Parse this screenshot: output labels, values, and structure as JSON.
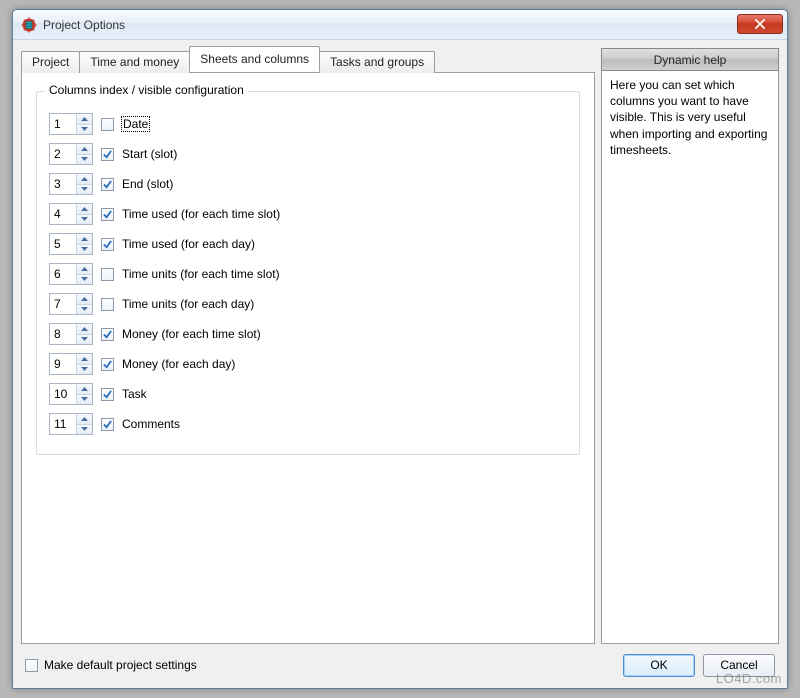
{
  "window": {
    "title": "Project Options"
  },
  "tabs": [
    {
      "label": "Project"
    },
    {
      "label": "Time and money"
    },
    {
      "label": "Sheets and columns"
    },
    {
      "label": "Tasks and groups"
    }
  ],
  "active_tab_index": 2,
  "group_title": "Columns index / visible configuration",
  "columns": [
    {
      "index": "1",
      "checked": false,
      "label": "Date",
      "focused": true
    },
    {
      "index": "2",
      "checked": true,
      "label": "Start (slot)"
    },
    {
      "index": "3",
      "checked": true,
      "label": "End (slot)"
    },
    {
      "index": "4",
      "checked": true,
      "label": "Time used (for each time slot)"
    },
    {
      "index": "5",
      "checked": true,
      "label": "Time used (for each day)"
    },
    {
      "index": "6",
      "checked": false,
      "label": "Time units (for each time slot)"
    },
    {
      "index": "7",
      "checked": false,
      "label": "Time units (for each day)"
    },
    {
      "index": "8",
      "checked": true,
      "label": "Money (for each time slot)"
    },
    {
      "index": "9",
      "checked": true,
      "label": "Money (for each day)"
    },
    {
      "index": "10",
      "checked": true,
      "label": "Task"
    },
    {
      "index": "11",
      "checked": true,
      "label": "Comments"
    }
  ],
  "help": {
    "header": "Dynamic help",
    "body": "Here you can set which columns you want to have visible. This is very useful when importing and exporting timesheets."
  },
  "bottom": {
    "make_default_checked": false,
    "make_default_label": "Make default project settings",
    "ok": "OK",
    "cancel": "Cancel"
  },
  "watermark": "LO4D.com"
}
